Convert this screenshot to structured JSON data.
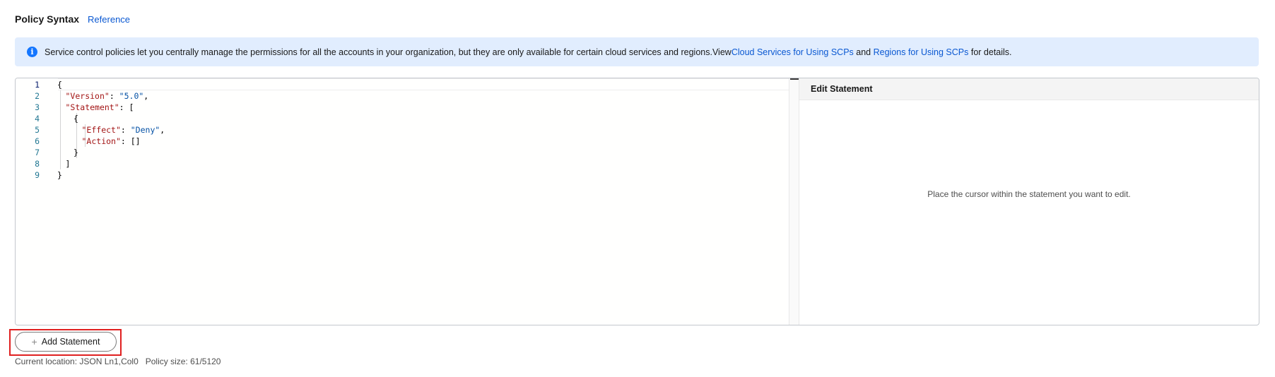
{
  "header": {
    "title": "Policy Syntax",
    "reference_link": "Reference"
  },
  "info": {
    "icon": "info-icon",
    "text": "Service control policies let you centrally manage the permissions for all the accounts in your organization, but they are only available for certain cloud services and regions.View ",
    "link1": "Cloud Services for Using SCPs",
    "mid": " and ",
    "link2": "Regions for Using SCPs",
    "tail": " for details."
  },
  "editor": {
    "lines": [
      {
        "n": "1",
        "text": "{"
      },
      {
        "n": "2",
        "text": "\"Version\": \"5.0\","
      },
      {
        "n": "3",
        "text": "\"Statement\": ["
      },
      {
        "n": "4",
        "text": "{"
      },
      {
        "n": "5",
        "text": "\"Effect\": \"Deny\","
      },
      {
        "n": "6",
        "text": "\"Action\": []"
      },
      {
        "n": "7",
        "text": "}"
      },
      {
        "n": "8",
        "text": "]"
      },
      {
        "n": "9",
        "text": "}"
      }
    ]
  },
  "statement_panel": {
    "title": "Edit Statement",
    "hint": "Place the cursor within the statement you want to edit."
  },
  "actions": {
    "add_statement": "Add Statement"
  },
  "status": {
    "location": "Current location: JSON Ln1,Col0",
    "size": "Policy size: 61/5120"
  }
}
